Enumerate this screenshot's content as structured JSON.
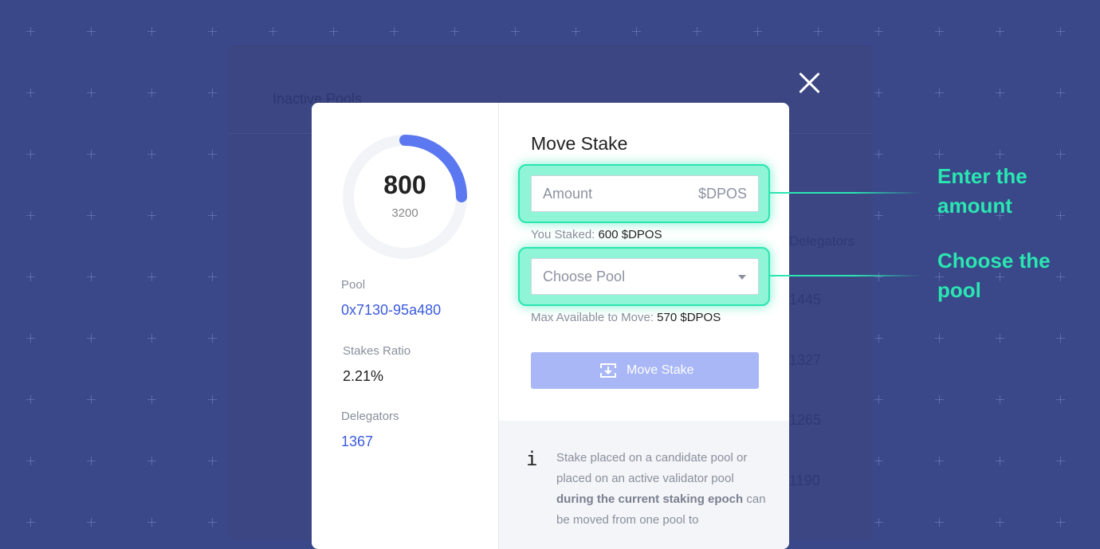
{
  "background": {
    "tab_label": "Inactive Pools",
    "column_label": "Delegators",
    "values": [
      "1445",
      "1327",
      "1265",
      "1190"
    ]
  },
  "pool_summary": {
    "staked": 800,
    "total": 3200,
    "pool_label": "Pool",
    "pool_address": "0x7130-95a480",
    "stakes_ratio_label": "Stakes Ratio",
    "stakes_ratio_value": "2.21%",
    "delegators_label": "Delegators",
    "delegators_value": "1367"
  },
  "move_stake": {
    "title": "Move Stake",
    "amount_placeholder": "Amount",
    "amount_unit": "$DPOS",
    "you_staked_label": "You Staked:",
    "you_staked_value": "600 $DPOS",
    "pool_select_placeholder": "Choose Pool",
    "max_available_label": "Max Available to Move:",
    "max_available_value": "570 $DPOS",
    "button_label": "Move Stake"
  },
  "info": {
    "icon": "i",
    "text_part1": "Stake placed on a candidate pool or placed on an active validator pool ",
    "text_bold": "during the current staking epoch",
    "text_part2": " can be moved from one pool to"
  },
  "annotations": {
    "amount_line1": "Enter the",
    "amount_line2": "amount",
    "pool_line1": "Choose the",
    "pool_line2": "pool"
  },
  "colors": {
    "background": "#23306f",
    "accent": "#2ae6b1",
    "link": "#3b5bdb",
    "button": "#a9b7f6",
    "gauge": "#5b78f0"
  }
}
